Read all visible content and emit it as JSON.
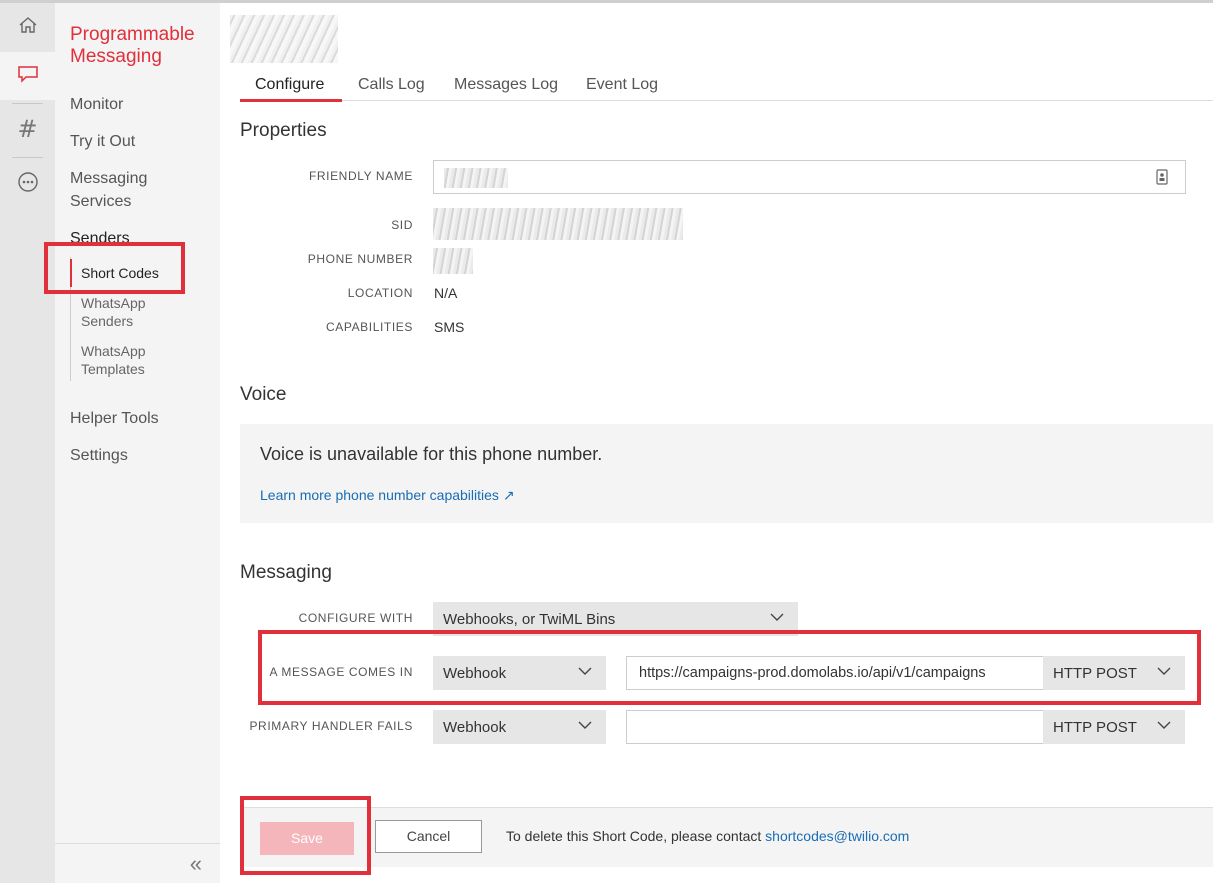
{
  "nav": {
    "title_line1": "Programmable",
    "title_line2": "Messaging",
    "monitor": "Monitor",
    "try_it_out": "Try it Out",
    "messaging_services_1": "Messaging",
    "messaging_services_2": "Services",
    "senders": "Senders",
    "short_codes": "Short Codes",
    "whatsapp_senders_1": "WhatsApp",
    "whatsapp_senders_2": "Senders",
    "whatsapp_templates_1": "WhatsApp",
    "whatsapp_templates_2": "Templates",
    "helper_tools": "Helper Tools",
    "settings": "Settings",
    "collapse": "«"
  },
  "rail_icons": [
    "home-icon",
    "chat-icon",
    "hash-icon",
    "more-icon"
  ],
  "tabs": [
    "Configure",
    "Calls Log",
    "Messages Log",
    "Event Log"
  ],
  "properties": {
    "heading": "Properties",
    "friendly_name_label": "FRIENDLY NAME",
    "sid_label": "SID",
    "phone_number_label": "PHONE NUMBER",
    "location_label": "LOCATION",
    "location_value": "N/A",
    "capabilities_label": "CAPABILITIES",
    "capabilities_value": "SMS"
  },
  "voice": {
    "heading": "Voice",
    "unavailable": "Voice is unavailable for this phone number.",
    "learn_more": "Learn more phone number capabilities ↗"
  },
  "messaging": {
    "heading": "Messaging",
    "configure_with_label": "CONFIGURE WITH",
    "configure_with_value": "Webhooks, or TwiML Bins",
    "message_comes_in_label": "A MESSAGE COMES IN",
    "message_comes_in_type": "Webhook",
    "message_comes_in_url": "https://campaigns-prod.domolabs.io/api/v1/campaigns",
    "message_comes_in_method": "HTTP POST",
    "primary_fails_label": "PRIMARY HANDLER FAILS",
    "primary_fails_type": "Webhook",
    "primary_fails_url": "",
    "primary_fails_method": "HTTP POST"
  },
  "footer": {
    "save": "Save",
    "cancel": "Cancel",
    "delete_text": "To delete this Short Code, please contact ",
    "delete_email": "shortcodes@twilio.com"
  },
  "colors": {
    "accent": "#e0303c",
    "link": "#1a6cb5",
    "save_disabled": "#f4b6bb"
  }
}
